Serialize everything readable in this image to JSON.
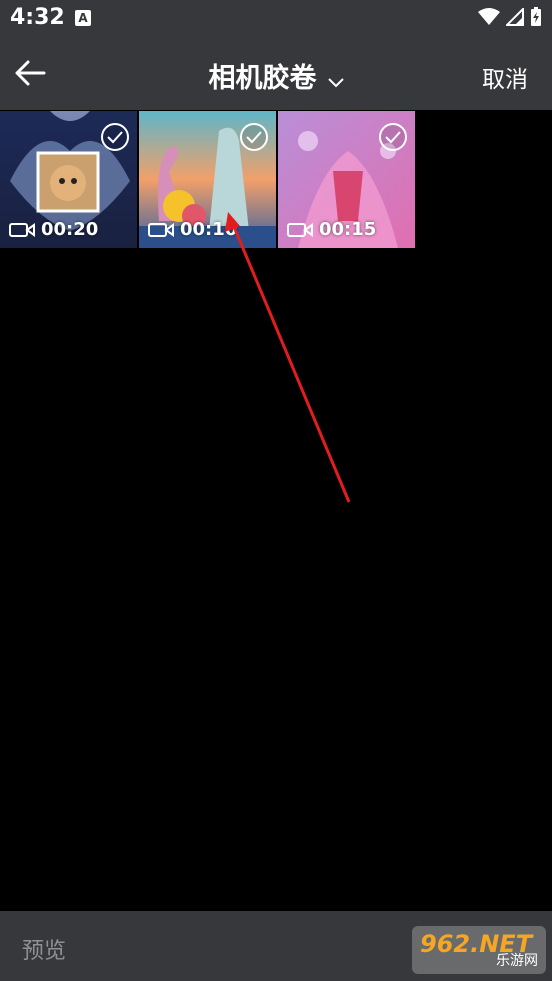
{
  "status_bar": {
    "time": "4:32",
    "notification_letter": "A"
  },
  "app_bar": {
    "title": "相机胶卷",
    "cancel_label": "取消"
  },
  "videos": [
    {
      "duration": "00:20",
      "selected": true
    },
    {
      "duration": "00:10",
      "selected": true
    },
    {
      "duration": "00:15",
      "selected": true
    }
  ],
  "bottom_bar": {
    "preview_label": "预览"
  },
  "watermark": {
    "brand": "962.NET",
    "sub": "乐游网"
  },
  "colors": {
    "bar_bg": "#37383b",
    "annotation_arrow": "#e11d1d",
    "disabled_text": "#8f9094"
  }
}
